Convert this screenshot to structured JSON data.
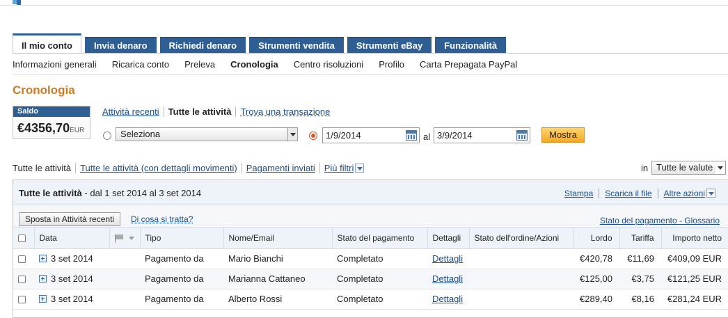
{
  "tabs": [
    {
      "label": "Il mio conto",
      "active": true
    },
    {
      "label": "Invia denaro"
    },
    {
      "label": "Richiedi denaro"
    },
    {
      "label": "Strumenti vendita"
    },
    {
      "label": "Strumenti eBay"
    },
    {
      "label": "Funzionalità"
    }
  ],
  "subnav": [
    {
      "label": "Informazioni generali"
    },
    {
      "label": "Ricarica conto"
    },
    {
      "label": "Preleva"
    },
    {
      "label": "Cronologia",
      "active": true
    },
    {
      "label": "Centro risoluzioni"
    },
    {
      "label": "Profilo"
    },
    {
      "label": "Carta Prepagata PayPal"
    }
  ],
  "page_title": "Cronologia",
  "balance": {
    "label": "Saldo",
    "amount": "€4356,70",
    "currency": "EUR"
  },
  "views": {
    "recent": "Attività recenti",
    "all": "Tutte le attività",
    "find": "Trova una transazione"
  },
  "range": {
    "select_value": "Seleziona",
    "from": "1/9/2014",
    "to_label": "al",
    "to": "3/9/2014",
    "show_button": "Mostra"
  },
  "filters": {
    "all": "Tutte le attività",
    "all_detailed": "Tutte le attività (con dettagli movimenti)",
    "sent": "Pagamenti inviati",
    "more": "Più filtri",
    "currency_label": "in",
    "currency_value": "Tutte le valute"
  },
  "panel": {
    "title_bold": "Tutte le attività",
    "title_rest": " - dal 1 set 2014 al 3 set 2014",
    "print": "Stampa",
    "download": "Scarica il file",
    "other": "Altre azioni",
    "move_button": "Sposta in Attività recenti",
    "what": "Di cosa si tratta?",
    "glossary": "Stato del pagamento - Glossario"
  },
  "columns": {
    "date": "Data",
    "type": "Tipo",
    "name": "Nome/Email",
    "status": "Stato del pagamento",
    "details": "Dettagli",
    "order": "Stato dell'ordine/Azioni",
    "gross": "Lordo",
    "fee": "Tariffa",
    "net": "Importo netto"
  },
  "rows": [
    {
      "date": "3 set 2014",
      "type": "Pagamento da",
      "name": "Mario Bianchi",
      "status": "Completato",
      "details": "Dettagli",
      "gross": "€420,78",
      "fee": "€11,69",
      "net": "€409,09 EUR"
    },
    {
      "date": "3 set 2014",
      "type": "Pagamento da",
      "name": "Marianna Cattaneo",
      "status": "Completato",
      "details": "Dettagli",
      "gross": "€125,00",
      "fee": "€3,75",
      "net": "€121,25 EUR"
    },
    {
      "date": "3 set 2014",
      "type": "Pagamento da",
      "name": "Alberto Rossi",
      "status": "Completato",
      "details": "Dettagli",
      "gross": "€289,40",
      "fee": "€8,16",
      "net": "€281,24 EUR"
    }
  ],
  "colors": {
    "tab_blue": "#2f5e92",
    "title_orange": "#c87c28",
    "button_orange": "#f2a829",
    "link_blue": "#1a4e8a"
  }
}
